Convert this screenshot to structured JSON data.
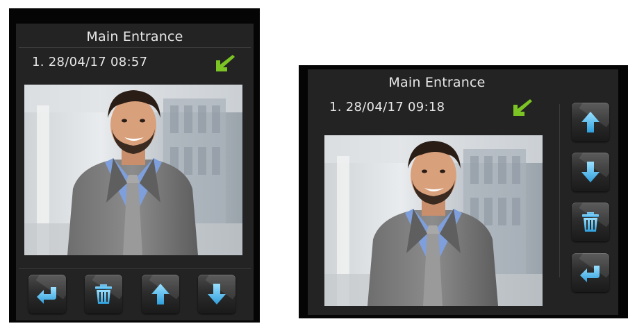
{
  "panel_left": {
    "title": "Main Entrance",
    "record": "1. 28/04/17 08:57",
    "indicator_icon": "incoming-arrow-icon",
    "buttons": [
      "back-icon",
      "trash-icon",
      "arrow-up-icon",
      "arrow-down-icon"
    ]
  },
  "panel_right": {
    "title": "Main Entrance",
    "record": "1. 28/04/17 09:18",
    "indicator_icon": "incoming-arrow-icon",
    "buttons": [
      "arrow-up-icon",
      "arrow-down-icon",
      "trash-icon",
      "back-icon"
    ]
  },
  "colors": {
    "accent_green": "#7cc424",
    "icon_blue": "#5ec0f0",
    "screen_bg": "#232323",
    "bezel": "#050505"
  }
}
